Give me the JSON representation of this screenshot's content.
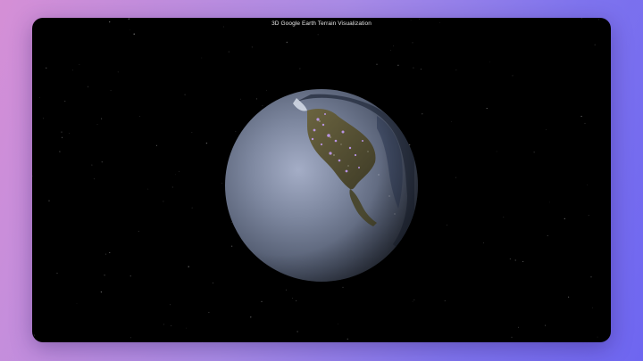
{
  "window": {
    "title": "3D Google Earth Terrain Visualization"
  },
  "globe": {
    "icon": "earth-globe",
    "ocean_color": "#5f6a80",
    "land_color": "#5a5636",
    "city_light_color": "#c9a0ff"
  },
  "colors": {
    "background_left": "#d58fd6",
    "background_right": "#6e66f0",
    "canvas": "#000000"
  }
}
